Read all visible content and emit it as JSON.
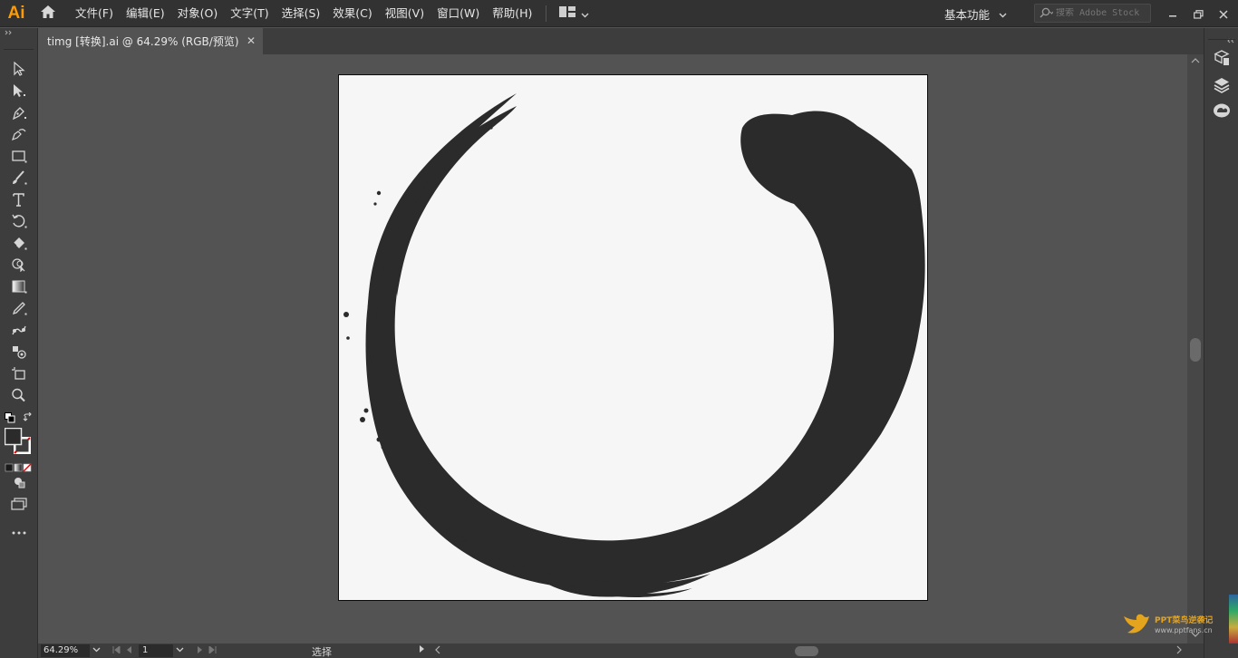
{
  "app": {
    "logo": "Ai"
  },
  "menu": [
    "文件(F)",
    "编辑(E)",
    "对象(O)",
    "文字(T)",
    "选择(S)",
    "效果(C)",
    "视图(V)",
    "窗口(W)",
    "帮助(H)"
  ],
  "workspace": {
    "label": "基本功能"
  },
  "search": {
    "placeholder": "搜索 Adobe Stock"
  },
  "document": {
    "tab_title": "timg [转换].ai @ 64.29% (RGB/预览)"
  },
  "status": {
    "zoom": "64.29%",
    "page": "1",
    "tool_name": "选择"
  },
  "watermark": {
    "title": "PPT菜鸟逆袭记",
    "url": "www.pptfans.cn"
  },
  "colors": {
    "accent": "#ff9a00",
    "artboard": "#f6f6f6",
    "ink": "#2b2b2b",
    "ui_dark": "#323232",
    "ui_panel": "#3d3d3d",
    "canvas": "#535353"
  }
}
